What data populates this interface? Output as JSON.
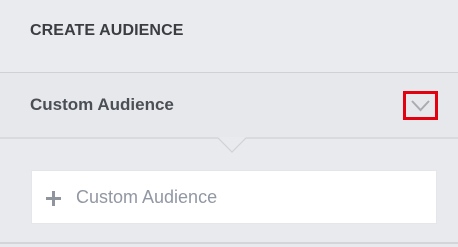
{
  "header": {
    "title": "CREATE AUDIENCE"
  },
  "section": {
    "title": "Custom Audience",
    "toggle_icon": "chevron-down-icon",
    "toggle_highlight_color": "#e3000f"
  },
  "add_field": {
    "icon": "plus-icon",
    "label": "Custom Audience"
  }
}
